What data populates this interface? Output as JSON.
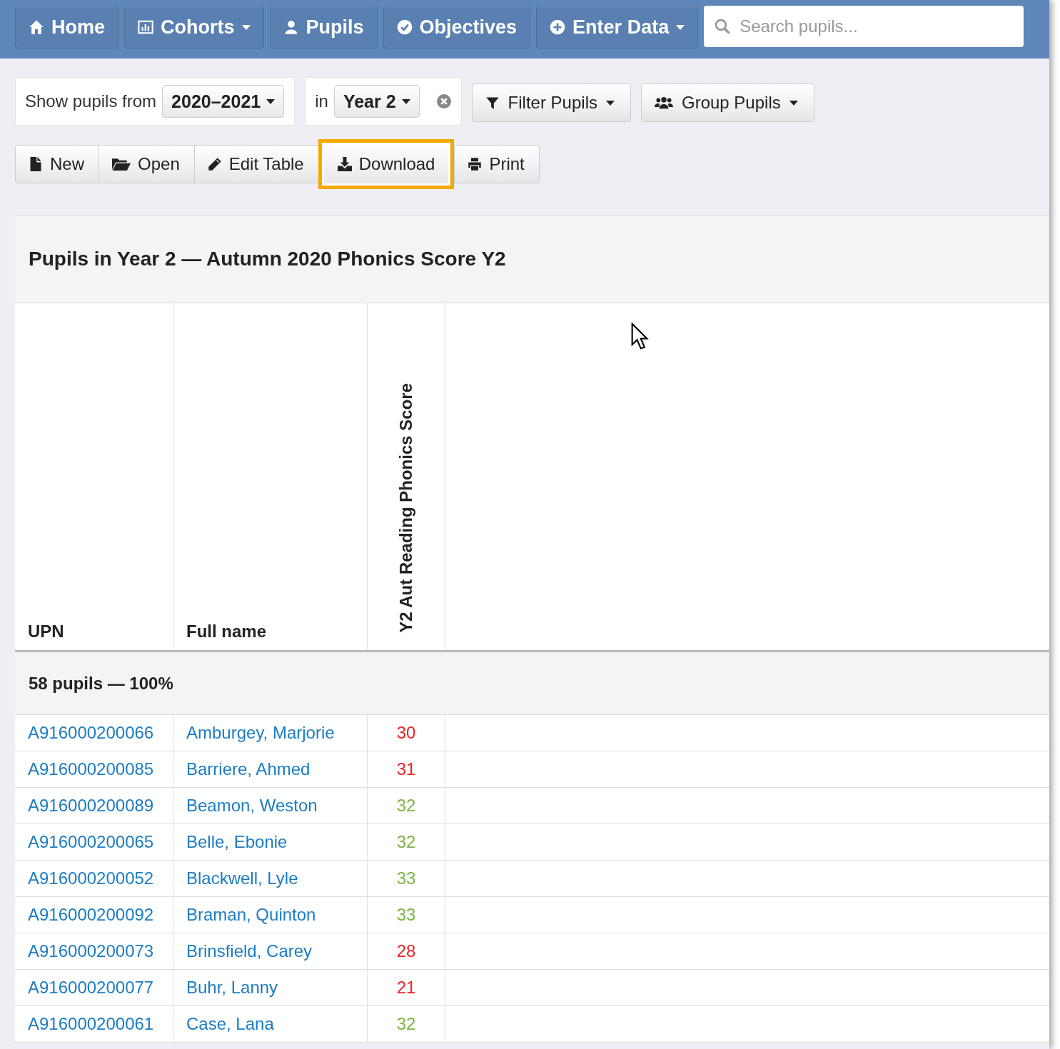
{
  "nav": {
    "items": [
      {
        "label": "Home",
        "dropdown": false
      },
      {
        "label": "Cohorts",
        "dropdown": true
      },
      {
        "label": "Pupils",
        "dropdown": false
      },
      {
        "label": "Objectives",
        "dropdown": false
      },
      {
        "label": "Enter Data",
        "dropdown": true
      }
    ],
    "search": {
      "placeholder": "Search pupils..."
    }
  },
  "filters": {
    "from_label": "Show pupils from",
    "year_range": "2020–2021",
    "in_label": "in",
    "year_group": "Year 2",
    "filter_button": "Filter Pupils",
    "group_button": "Group Pupils"
  },
  "toolbar": [
    {
      "label": "New",
      "highlighted": false
    },
    {
      "label": "Open",
      "highlighted": false
    },
    {
      "label": "Edit Table",
      "highlighted": false
    },
    {
      "label": "Download",
      "highlighted": true
    },
    {
      "label": "Print",
      "highlighted": false
    }
  ],
  "panel": {
    "title": "Pupils in Year 2 — Autumn 2020 Phonics Score Y2"
  },
  "table": {
    "columns": [
      "UPN",
      "Full name",
      "Y2 Aut Reading Phonics Score"
    ],
    "summary": "58 pupils — 100%",
    "rows": [
      {
        "upn": "A916000200066",
        "name": "Amburgey, Marjorie",
        "score": "30",
        "color": "#ee2222"
      },
      {
        "upn": "A916000200085",
        "name": "Barriere, Ahmed",
        "score": "31",
        "color": "#ee2222"
      },
      {
        "upn": "A916000200089",
        "name": "Beamon, Weston",
        "score": "32",
        "color": "#7cb342"
      },
      {
        "upn": "A916000200065",
        "name": "Belle, Ebonie",
        "score": "32",
        "color": "#7cb342"
      },
      {
        "upn": "A916000200052",
        "name": "Blackwell, Lyle",
        "score": "33",
        "color": "#7cb342"
      },
      {
        "upn": "A916000200092",
        "name": "Braman, Quinton",
        "score": "33",
        "color": "#7cb342"
      },
      {
        "upn": "A916000200073",
        "name": "Brinsfield, Carey",
        "score": "28",
        "color": "#ee2222"
      },
      {
        "upn": "A916000200077",
        "name": "Buhr, Lanny",
        "score": "21",
        "color": "#ee2222"
      },
      {
        "upn": "A916000200061",
        "name": "Case, Lana",
        "score": "32",
        "color": "#7cb342"
      }
    ]
  }
}
